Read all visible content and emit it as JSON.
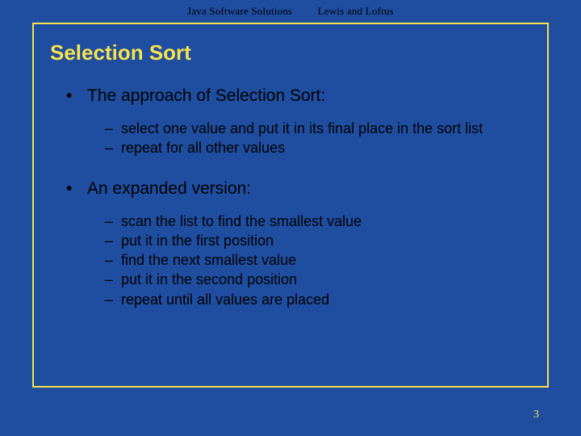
{
  "header": {
    "book": "Java Software Solutions",
    "authors": "Lewis and Loftus"
  },
  "slide": {
    "title": "Selection Sort",
    "point1": "The approach of Selection Sort:",
    "sub1": [
      "select one value and put it in its final place in the sort list",
      "repeat for all other values"
    ],
    "point2": "An expanded version:",
    "sub2": [
      "scan the list to find the smallest value",
      "put it in the first position",
      "find the next smallest value",
      "put it in the second position",
      "repeat until all values are placed"
    ]
  },
  "page_number": "3"
}
